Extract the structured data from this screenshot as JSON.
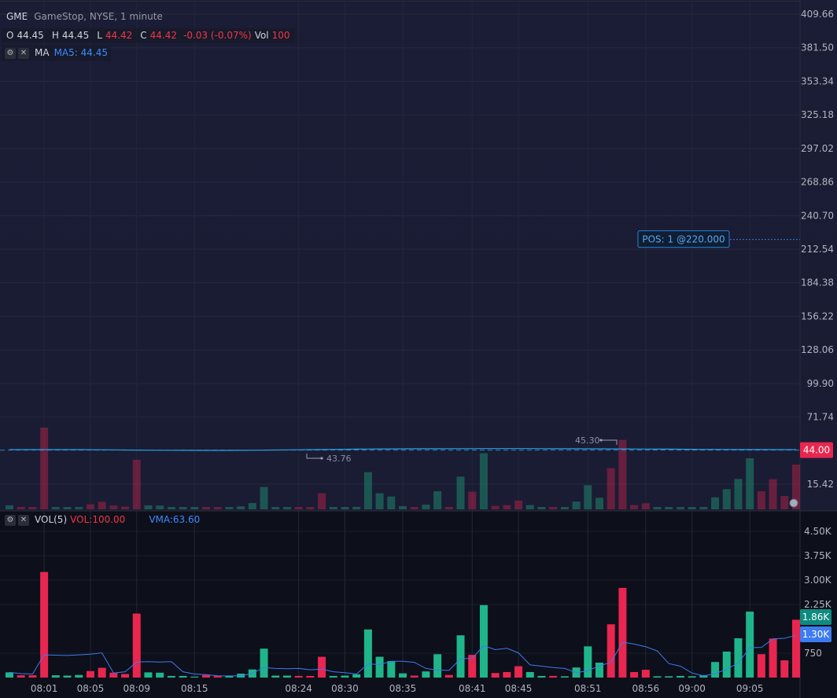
{
  "symbol": {
    "ticker": "GME",
    "description": "GameStop, NYSE, 1 minute"
  },
  "ohlc": {
    "o_label": "O",
    "o": "44.45",
    "h_label": "H",
    "h": "44.45",
    "l_label": "L",
    "l": "44.42",
    "c_label": "C",
    "c": "44.42",
    "change": "-0.03 (-0.07%)",
    "vol_label": "Vol",
    "vol": "100"
  },
  "ma_indicator": {
    "name": "MA",
    "value_text": "MA5: 44.45"
  },
  "vol_indicator": {
    "name": "VOL(5)",
    "vol_text": "VOL:100.00",
    "vma_text": "VMA:63.60"
  },
  "colors": {
    "up": "#1fb58a",
    "down": "#e8264f",
    "background_top": "#1b1d36",
    "background_bottom": "#0d0f1a",
    "ma_line": "#2b9fe8",
    "vma_line": "#3d7bf0",
    "position_line": "#2b7fd6"
  },
  "icons": {
    "settings": "gear-icon",
    "close": "close-icon"
  },
  "chart_data": {
    "type": "candlestick",
    "price_axis": {
      "ticks": [
        "409.66",
        "381.50",
        "353.34",
        "325.18",
        "297.02",
        "268.86",
        "240.70",
        "212.54",
        "184.38",
        "156.22",
        "128.06",
        "99.90",
        "71.74",
        "15.42"
      ],
      "range": [
        0,
        420
      ]
    },
    "time_axis": {
      "ticks": [
        "08:01",
        "08:05",
        "08:09",
        "08:15",
        "08:24",
        "08:30",
        "08:35",
        "08:41",
        "08:45",
        "08:51",
        "08:56",
        "09:00",
        "09:05"
      ]
    },
    "current_price": "44.00",
    "position": {
      "label": "POS: 1 @220.000",
      "price": 220.0
    },
    "markers": [
      {
        "label": "43.76",
        "price": 43.76
      },
      {
        "label": "45.30",
        "price": 45.3
      }
    ],
    "volume_axis": {
      "ticks": [
        "4.50K",
        "3.75K",
        "3.00K",
        "2.25K",
        "750"
      ],
      "range": [
        0,
        4500
      ]
    },
    "volume_badges": [
      {
        "label": "1.86K",
        "value": 1860
      },
      {
        "label": "1.30K",
        "value": 1300
      }
    ],
    "volume": [
      160,
      70,
      70,
      3250,
      70,
      60,
      80,
      200,
      300,
      150,
      110,
      1970,
      160,
      150,
      50,
      50,
      30,
      80,
      50,
      50,
      120,
      250,
      890,
      60,
      60,
      50,
      50,
      640,
      50,
      60,
      100,
      1480,
      640,
      510,
      130,
      60,
      190,
      720,
      80,
      1300,
      700,
      2230,
      140,
      170,
      350,
      170,
      50,
      50,
      40,
      310,
      960,
      460,
      1640,
      2760,
      170,
      240,
      40,
      40,
      50,
      40,
      70,
      480,
      800,
      1210,
      2030,
      720,
      1200,
      530,
      1780
    ],
    "up": [
      true,
      false,
      false,
      false,
      true,
      true,
      true,
      false,
      false,
      false,
      false,
      false,
      true,
      true,
      true,
      true,
      true,
      false,
      false,
      true,
      true,
      true,
      true,
      true,
      true,
      false,
      false,
      false,
      true,
      true,
      true,
      true,
      true,
      true,
      true,
      false,
      true,
      true,
      false,
      true,
      false,
      true,
      false,
      false,
      false,
      true,
      true,
      false,
      true,
      true,
      true,
      true,
      false,
      false,
      false,
      false,
      true,
      true,
      true,
      true,
      true,
      true,
      true,
      true,
      true,
      false,
      false,
      false,
      false
    ],
    "vma": [
      160,
      120,
      110,
      700,
      690,
      680,
      700,
      720,
      760,
      140,
      180,
      480,
      490,
      480,
      490,
      180,
      110,
      90,
      55,
      50,
      50,
      130,
      310,
      280,
      270,
      280,
      240,
      260,
      180,
      150,
      110,
      420,
      400,
      500,
      500,
      470,
      280,
      230,
      220,
      580,
      590,
      980,
      860,
      900,
      760,
      390,
      350,
      310,
      280,
      150,
      210,
      360,
      470,
      1090,
      1030,
      950,
      820,
      430,
      350,
      140,
      50,
      120,
      260,
      450,
      920,
      930,
      1190,
      1210,
      1300
    ],
    "ma5": [
      44.45,
      44.45,
      44.44,
      44.43,
      44.43,
      44.42,
      44.4,
      44.38,
      44.3,
      44.22,
      44.12,
      44.05,
      43.98,
      43.92,
      43.88,
      43.84,
      43.8,
      43.76,
      43.76,
      43.78,
      43.82,
      43.9,
      44.0,
      44.1,
      44.2,
      44.3,
      44.4,
      44.5,
      44.6,
      44.7,
      44.8,
      44.9,
      45.0,
      45.05,
      45.1,
      45.12,
      45.15,
      45.18,
      45.2,
      45.22,
      45.25,
      45.28,
      45.3,
      45.3,
      45.28,
      45.26,
      45.22,
      45.18,
      45.15,
      45.12,
      45.1,
      45.08,
      45.05,
      45.0,
      44.95,
      44.9,
      44.85,
      44.8,
      44.75,
      44.7,
      44.65,
      44.6,
      44.55,
      44.52,
      44.5,
      44.48,
      44.46,
      44.45,
      44.45
    ]
  }
}
